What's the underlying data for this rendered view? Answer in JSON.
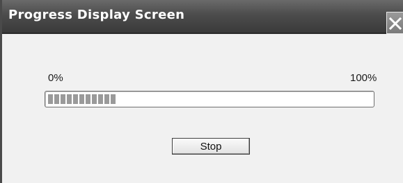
{
  "window": {
    "title": "Progress Display Screen",
    "close_icon": "close-icon"
  },
  "progress": {
    "min_label": "0%",
    "max_label": "100%",
    "fraction": 0.21
  },
  "actions": {
    "stop_label": "Stop"
  },
  "colors": {
    "titlebar": "#4c4c4c",
    "window_bg": "#f1f1f1",
    "progress_fill": "#9a9a9a"
  }
}
